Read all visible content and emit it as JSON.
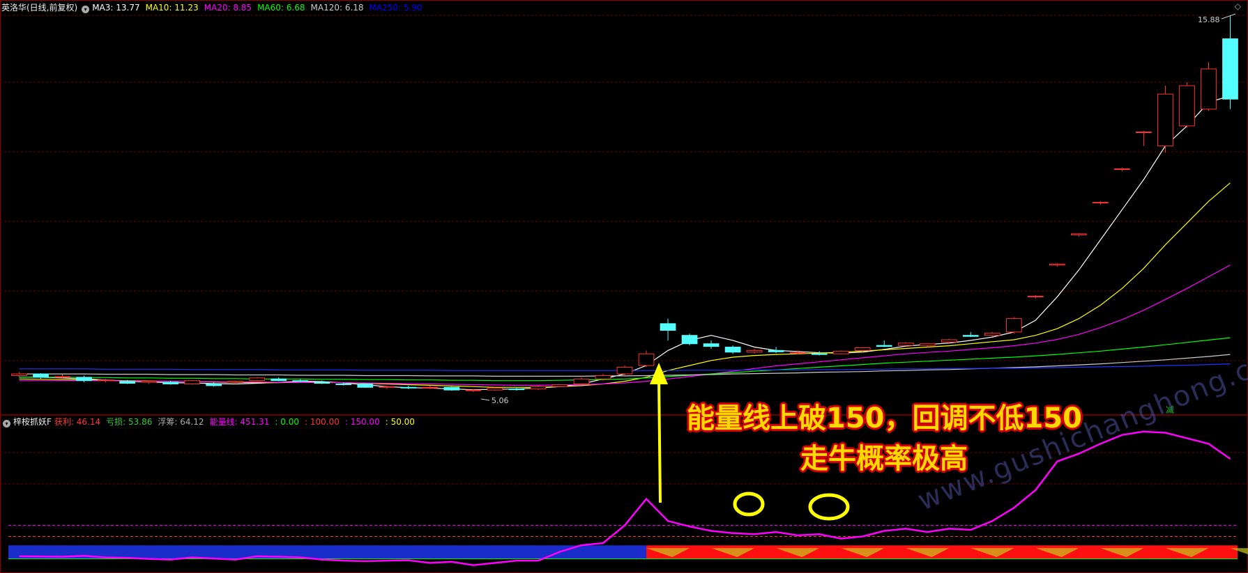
{
  "top_panel": {
    "title": "英洛华(日线,前复权)",
    "ma_items": [
      {
        "label": "MA3: 13.77",
        "color": "#ffffff"
      },
      {
        "label": "MA10: 11.23",
        "color": "#ffff00"
      },
      {
        "label": "MA20: 8.85",
        "color": "#ff00ff"
      },
      {
        "label": "MA60: 6.68",
        "color": "#00ff00"
      },
      {
        "label": "MA120: 6.18",
        "color": "#cccccc"
      },
      {
        "label": "MA250: 5.90",
        "color": "#0000ff"
      }
    ],
    "high_label": "15.88",
    "low_label": "5.06",
    "reduce_marker": "减"
  },
  "bottom_panel": {
    "title": "梓桉抓妖F",
    "items": [
      {
        "label": "获利: 46.14",
        "color": "#ff3333"
      },
      {
        "label": "亏损: 53.86",
        "color": "#33cc33"
      },
      {
        "label": "浮筹: 64.12",
        "color": "#aaaaaa"
      },
      {
        "label": "能量线: 451.31",
        "color": "#ff00ff"
      },
      {
        "label": ": 0.00",
        "color": "#00ff00"
      },
      {
        "label": ": 100.00",
        "color": "#ff3333"
      },
      {
        "label": ": 150.00",
        "color": "#ff00ff"
      },
      {
        "label": ": 50.00",
        "color": "#ffff00"
      }
    ]
  },
  "annotations": {
    "line1": "能量线上破150，回调不低150",
    "line2": "走牛概率极高"
  },
  "watermark": "www.gushichanghong.com",
  "chart_data": {
    "type": "candlestick",
    "price_range": [
      4.5,
      16.3
    ],
    "candles": [
      {
        "o": 5.55,
        "h": 5.65,
        "l": 5.5,
        "c": 5.6
      },
      {
        "o": 5.6,
        "h": 5.62,
        "l": 5.45,
        "c": 5.5
      },
      {
        "o": 5.5,
        "h": 5.58,
        "l": 5.45,
        "c": 5.52
      },
      {
        "o": 5.5,
        "h": 5.55,
        "l": 5.35,
        "c": 5.4
      },
      {
        "o": 5.4,
        "h": 5.45,
        "l": 5.35,
        "c": 5.42
      },
      {
        "o": 5.38,
        "h": 5.42,
        "l": 5.3,
        "c": 5.32
      },
      {
        "o": 5.35,
        "h": 5.4,
        "l": 5.3,
        "c": 5.38
      },
      {
        "o": 5.35,
        "h": 5.4,
        "l": 5.28,
        "c": 5.3
      },
      {
        "o": 5.3,
        "h": 5.42,
        "l": 5.28,
        "c": 5.4
      },
      {
        "o": 5.3,
        "h": 5.35,
        "l": 5.22,
        "c": 5.25
      },
      {
        "o": 5.35,
        "h": 5.4,
        "l": 5.3,
        "c": 5.38
      },
      {
        "o": 5.4,
        "h": 5.5,
        "l": 5.38,
        "c": 5.48
      },
      {
        "o": 5.45,
        "h": 5.5,
        "l": 5.38,
        "c": 5.4
      },
      {
        "o": 5.4,
        "h": 5.45,
        "l": 5.35,
        "c": 5.38
      },
      {
        "o": 5.35,
        "h": 5.4,
        "l": 5.3,
        "c": 5.32
      },
      {
        "o": 5.3,
        "h": 5.35,
        "l": 5.25,
        "c": 5.28
      },
      {
        "o": 5.3,
        "h": 5.32,
        "l": 5.18,
        "c": 5.2
      },
      {
        "o": 5.2,
        "h": 5.25,
        "l": 5.15,
        "c": 5.22
      },
      {
        "o": 5.2,
        "h": 5.25,
        "l": 5.15,
        "c": 5.18
      },
      {
        "o": 5.2,
        "h": 5.25,
        "l": 5.15,
        "c": 5.2
      },
      {
        "o": 5.2,
        "h": 5.22,
        "l": 5.1,
        "c": 5.12
      },
      {
        "o": 5.1,
        "h": 5.15,
        "l": 5.06,
        "c": 5.12
      },
      {
        "o": 5.12,
        "h": 5.2,
        "l": 5.1,
        "c": 5.18
      },
      {
        "o": 5.15,
        "h": 5.2,
        "l": 5.1,
        "c": 5.14
      },
      {
        "o": 5.15,
        "h": 5.25,
        "l": 5.12,
        "c": 5.22
      },
      {
        "o": 5.22,
        "h": 5.3,
        "l": 5.2,
        "c": 5.28
      },
      {
        "o": 5.3,
        "h": 5.5,
        "l": 5.28,
        "c": 5.45
      },
      {
        "o": 5.45,
        "h": 5.6,
        "l": 5.4,
        "c": 5.55
      },
      {
        "o": 5.6,
        "h": 5.85,
        "l": 5.55,
        "c": 5.8
      },
      {
        "o": 5.85,
        "h": 6.3,
        "l": 5.8,
        "c": 6.2
      },
      {
        "o": 7.1,
        "h": 7.25,
        "l": 6.6,
        "c": 6.9
      },
      {
        "o": 6.75,
        "h": 6.8,
        "l": 6.45,
        "c": 6.5
      },
      {
        "o": 6.5,
        "h": 6.6,
        "l": 6.35,
        "c": 6.42
      },
      {
        "o": 6.4,
        "h": 6.45,
        "l": 6.2,
        "c": 6.25
      },
      {
        "o": 6.25,
        "h": 6.35,
        "l": 6.2,
        "c": 6.3
      },
      {
        "o": 6.3,
        "h": 6.4,
        "l": 6.22,
        "c": 6.26
      },
      {
        "o": 6.22,
        "h": 6.3,
        "l": 6.18,
        "c": 6.24
      },
      {
        "o": 6.2,
        "h": 6.28,
        "l": 6.15,
        "c": 6.18
      },
      {
        "o": 6.2,
        "h": 6.3,
        "l": 6.18,
        "c": 6.28
      },
      {
        "o": 6.3,
        "h": 6.4,
        "l": 6.25,
        "c": 6.38
      },
      {
        "o": 6.45,
        "h": 6.6,
        "l": 6.4,
        "c": 6.42
      },
      {
        "o": 6.45,
        "h": 6.55,
        "l": 6.42,
        "c": 6.52
      },
      {
        "o": 6.45,
        "h": 6.52,
        "l": 6.4,
        "c": 6.5
      },
      {
        "o": 6.55,
        "h": 6.65,
        "l": 6.5,
        "c": 6.62
      },
      {
        "o": 6.75,
        "h": 6.85,
        "l": 6.7,
        "c": 6.72
      },
      {
        "o": 6.75,
        "h": 6.85,
        "l": 6.72,
        "c": 6.82
      },
      {
        "o": 6.85,
        "h": 7.3,
        "l": 6.8,
        "c": 7.25
      },
      {
        "o": 7.9,
        "h": 7.95,
        "l": 7.85,
        "c": 7.92
      },
      {
        "o": 8.85,
        "h": 8.9,
        "l": 8.8,
        "c": 8.88
      },
      {
        "o": 9.75,
        "h": 9.8,
        "l": 9.7,
        "c": 9.78
      },
      {
        "o": 10.7,
        "h": 10.75,
        "l": 10.65,
        "c": 10.72
      },
      {
        "o": 11.7,
        "h": 11.75,
        "l": 11.65,
        "c": 11.72
      },
      {
        "o": 12.8,
        "h": 12.85,
        "l": 12.4,
        "c": 12.82
      },
      {
        "o": 12.4,
        "h": 14.2,
        "l": 12.2,
        "c": 13.95
      },
      {
        "o": 13.0,
        "h": 14.3,
        "l": 12.95,
        "c": 14.2
      },
      {
        "o": 13.5,
        "h": 14.9,
        "l": 13.45,
        "c": 14.7
      },
      {
        "o": 15.6,
        "h": 16.3,
        "l": 13.5,
        "c": 13.8
      }
    ],
    "ma_lines": {
      "MA3": [
        5.5,
        5.5,
        5.48,
        5.45,
        5.42,
        5.38,
        5.36,
        5.34,
        5.33,
        5.31,
        5.3,
        5.32,
        5.35,
        5.38,
        5.37,
        5.33,
        5.28,
        5.22,
        5.19,
        5.18,
        5.15,
        5.13,
        5.14,
        5.15,
        5.18,
        5.22,
        5.3,
        5.45,
        5.6,
        5.85,
        6.3,
        6.6,
        6.75,
        6.6,
        6.4,
        6.3,
        6.27,
        6.23,
        6.22,
        6.25,
        6.33,
        6.43,
        6.48,
        6.52,
        6.6,
        6.7,
        6.85,
        7.2,
        7.9,
        8.7,
        9.6,
        10.5,
        11.4,
        12.4,
        13.0,
        13.7,
        13.9
      ],
      "MA10": [
        5.45,
        5.44,
        5.43,
        5.42,
        5.41,
        5.4,
        5.39,
        5.38,
        5.37,
        5.36,
        5.35,
        5.34,
        5.34,
        5.35,
        5.35,
        5.34,
        5.32,
        5.3,
        5.28,
        5.26,
        5.24,
        5.22,
        5.2,
        5.2,
        5.2,
        5.22,
        5.25,
        5.3,
        5.38,
        5.5,
        5.7,
        5.85,
        6.0,
        6.1,
        6.15,
        6.18,
        6.2,
        6.22,
        6.25,
        6.28,
        6.32,
        6.36,
        6.4,
        6.44,
        6.5,
        6.56,
        6.62,
        6.75,
        6.95,
        7.25,
        7.65,
        8.15,
        8.75,
        9.45,
        10.1,
        10.75,
        11.3
      ],
      "MA20": [
        5.4,
        5.4,
        5.4,
        5.4,
        5.4,
        5.39,
        5.38,
        5.38,
        5.37,
        5.37,
        5.36,
        5.36,
        5.35,
        5.35,
        5.34,
        5.34,
        5.33,
        5.32,
        5.31,
        5.3,
        5.29,
        5.28,
        5.27,
        5.26,
        5.26,
        5.27,
        5.28,
        5.3,
        5.33,
        5.38,
        5.45,
        5.52,
        5.6,
        5.68,
        5.76,
        5.84,
        5.9,
        5.96,
        6.02,
        6.08,
        6.14,
        6.2,
        6.24,
        6.28,
        6.33,
        6.38,
        6.44,
        6.52,
        6.63,
        6.78,
        6.98,
        7.22,
        7.5,
        7.82,
        8.15,
        8.5,
        8.85
      ],
      "MA60": [
        5.5,
        5.5,
        5.5,
        5.49,
        5.49,
        5.48,
        5.48,
        5.47,
        5.47,
        5.46,
        5.46,
        5.45,
        5.45,
        5.45,
        5.44,
        5.44,
        5.43,
        5.43,
        5.42,
        5.42,
        5.41,
        5.41,
        5.4,
        5.4,
        5.4,
        5.41,
        5.42,
        5.43,
        5.45,
        5.48,
        5.52,
        5.56,
        5.6,
        5.64,
        5.68,
        5.72,
        5.76,
        5.8,
        5.84,
        5.88,
        5.92,
        5.95,
        5.98,
        6.01,
        6.04,
        6.07,
        6.1,
        6.14,
        6.18,
        6.23,
        6.28,
        6.34,
        6.4,
        6.47,
        6.54,
        6.61,
        6.68
      ],
      "MA120": [
        5.6,
        5.6,
        5.6,
        5.6,
        5.59,
        5.59,
        5.59,
        5.58,
        5.58,
        5.58,
        5.57,
        5.57,
        5.57,
        5.56,
        5.56,
        5.56,
        5.55,
        5.55,
        5.55,
        5.54,
        5.54,
        5.54,
        5.53,
        5.53,
        5.53,
        5.53,
        5.53,
        5.54,
        5.54,
        5.55,
        5.56,
        5.57,
        5.58,
        5.6,
        5.61,
        5.62,
        5.63,
        5.65,
        5.66,
        5.67,
        5.69,
        5.7,
        5.72,
        5.73,
        5.75,
        5.77,
        5.79,
        5.81,
        5.84,
        5.87,
        5.9,
        5.94,
        5.98,
        6.02,
        6.07,
        6.12,
        6.18
      ],
      "MA250": [
        5.75,
        5.75,
        5.75,
        5.75,
        5.74,
        5.74,
        5.74,
        5.74,
        5.73,
        5.73,
        5.73,
        5.73,
        5.72,
        5.72,
        5.72,
        5.72,
        5.71,
        5.71,
        5.71,
        5.71,
        5.7,
        5.7,
        5.7,
        5.7,
        5.7,
        5.7,
        5.7,
        5.7,
        5.7,
        5.7,
        5.7,
        5.71,
        5.71,
        5.71,
        5.72,
        5.72,
        5.72,
        5.73,
        5.73,
        5.74,
        5.74,
        5.75,
        5.75,
        5.76,
        5.76,
        5.77,
        5.77,
        5.78,
        5.79,
        5.8,
        5.81,
        5.82,
        5.83,
        5.85,
        5.86,
        5.88,
        5.9
      ]
    },
    "indicator_range": [
      -50,
      600
    ],
    "energy_line": [
      10,
      9,
      8,
      12,
      5,
      3,
      -2,
      -5,
      5,
      0,
      -5,
      10,
      8,
      5,
      -5,
      -10,
      -12,
      -10,
      -8,
      -20,
      -15,
      -30,
      -20,
      -10,
      -10,
      30,
      60,
      70,
      150,
      270,
      170,
      145,
      125,
      115,
      110,
      120,
      105,
      110,
      90,
      100,
      125,
      135,
      120,
      135,
      130,
      170,
      230,
      310,
      440,
      475,
      520,
      560,
      575,
      570,
      545,
      520,
      451.31
    ],
    "reference_levels": [
      0,
      50,
      100,
      150
    ]
  }
}
